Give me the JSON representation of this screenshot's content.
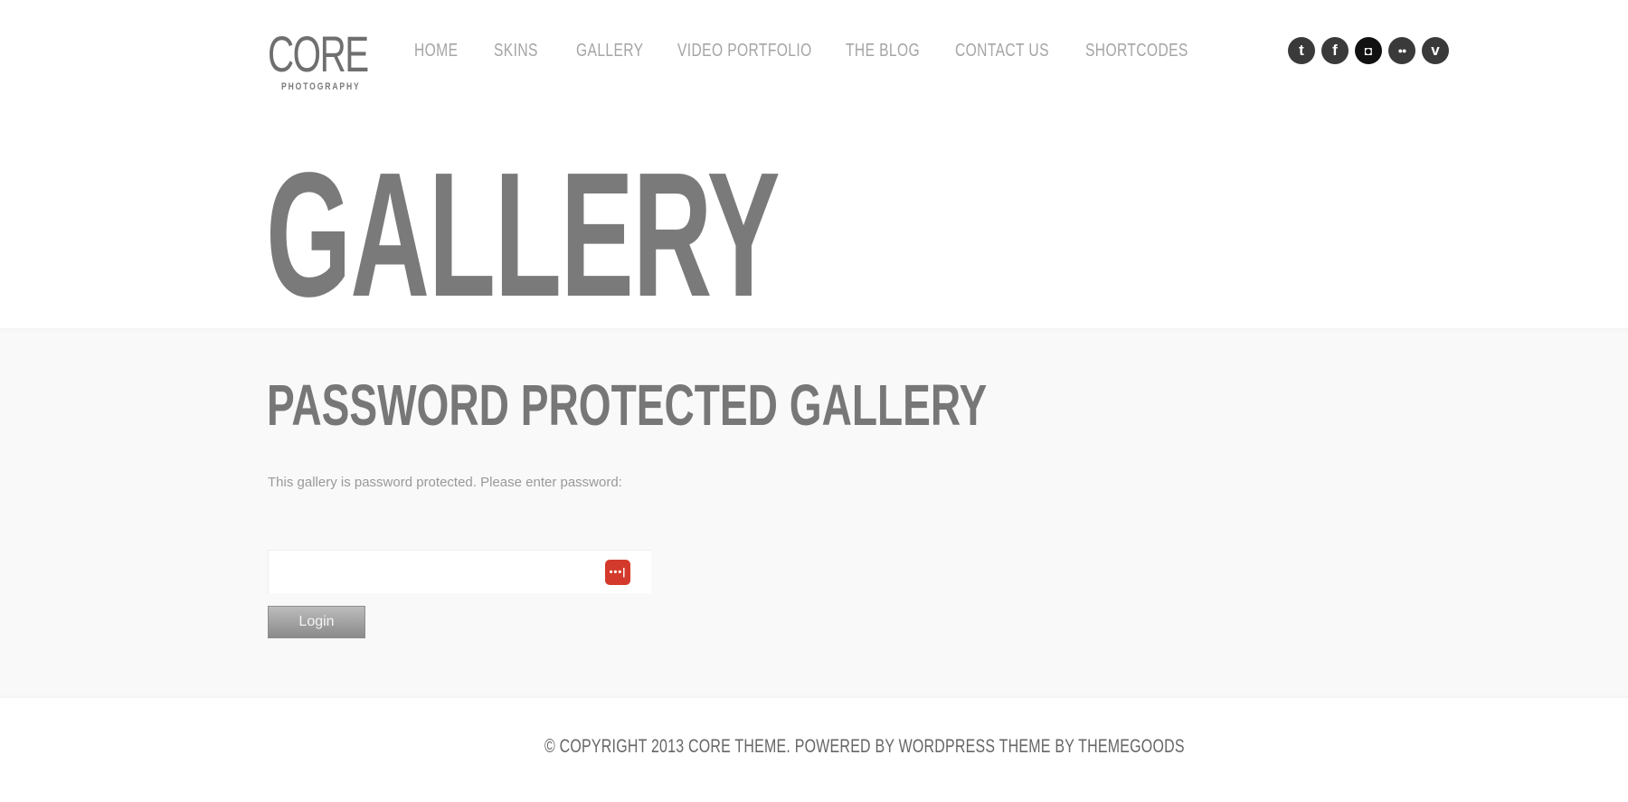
{
  "header": {
    "logo": {
      "main": "CORE",
      "sub": "PHOTOGRAPHY"
    },
    "nav": [
      {
        "label": "HOME"
      },
      {
        "label": "SKINS"
      },
      {
        "label": "GALLERY"
      },
      {
        "label": "VIDEO PORTFOLIO"
      },
      {
        "label": "THE BLOG"
      },
      {
        "label": "CONTACT US"
      },
      {
        "label": "SHORTCODES"
      }
    ],
    "social": [
      {
        "name": "twitter-icon",
        "glyph": "t"
      },
      {
        "name": "facebook-icon",
        "glyph": "f"
      },
      {
        "name": "instagram-icon",
        "glyph": "◘"
      },
      {
        "name": "flickr-icon",
        "glyph": "●●"
      },
      {
        "name": "vimeo-icon",
        "glyph": "v"
      }
    ]
  },
  "page": {
    "title": "GALLERY"
  },
  "content": {
    "section_title": "PASSWORD PROTECTED GALLERY",
    "intro": "This gallery is password protected. Please enter password:",
    "password_value": "",
    "password_manager_glyph": "•••|",
    "login_label": "Login"
  },
  "footer": {
    "text": "© COPYRIGHT 2013 CORE THEME. POWERED BY WORDPRESS THEME BY THEMEGOODS"
  },
  "colors": {
    "content_bg": "#f9f9f9",
    "password_manager_accent": "#d33a2c",
    "social_icon_bg": "#3a3a3a"
  }
}
